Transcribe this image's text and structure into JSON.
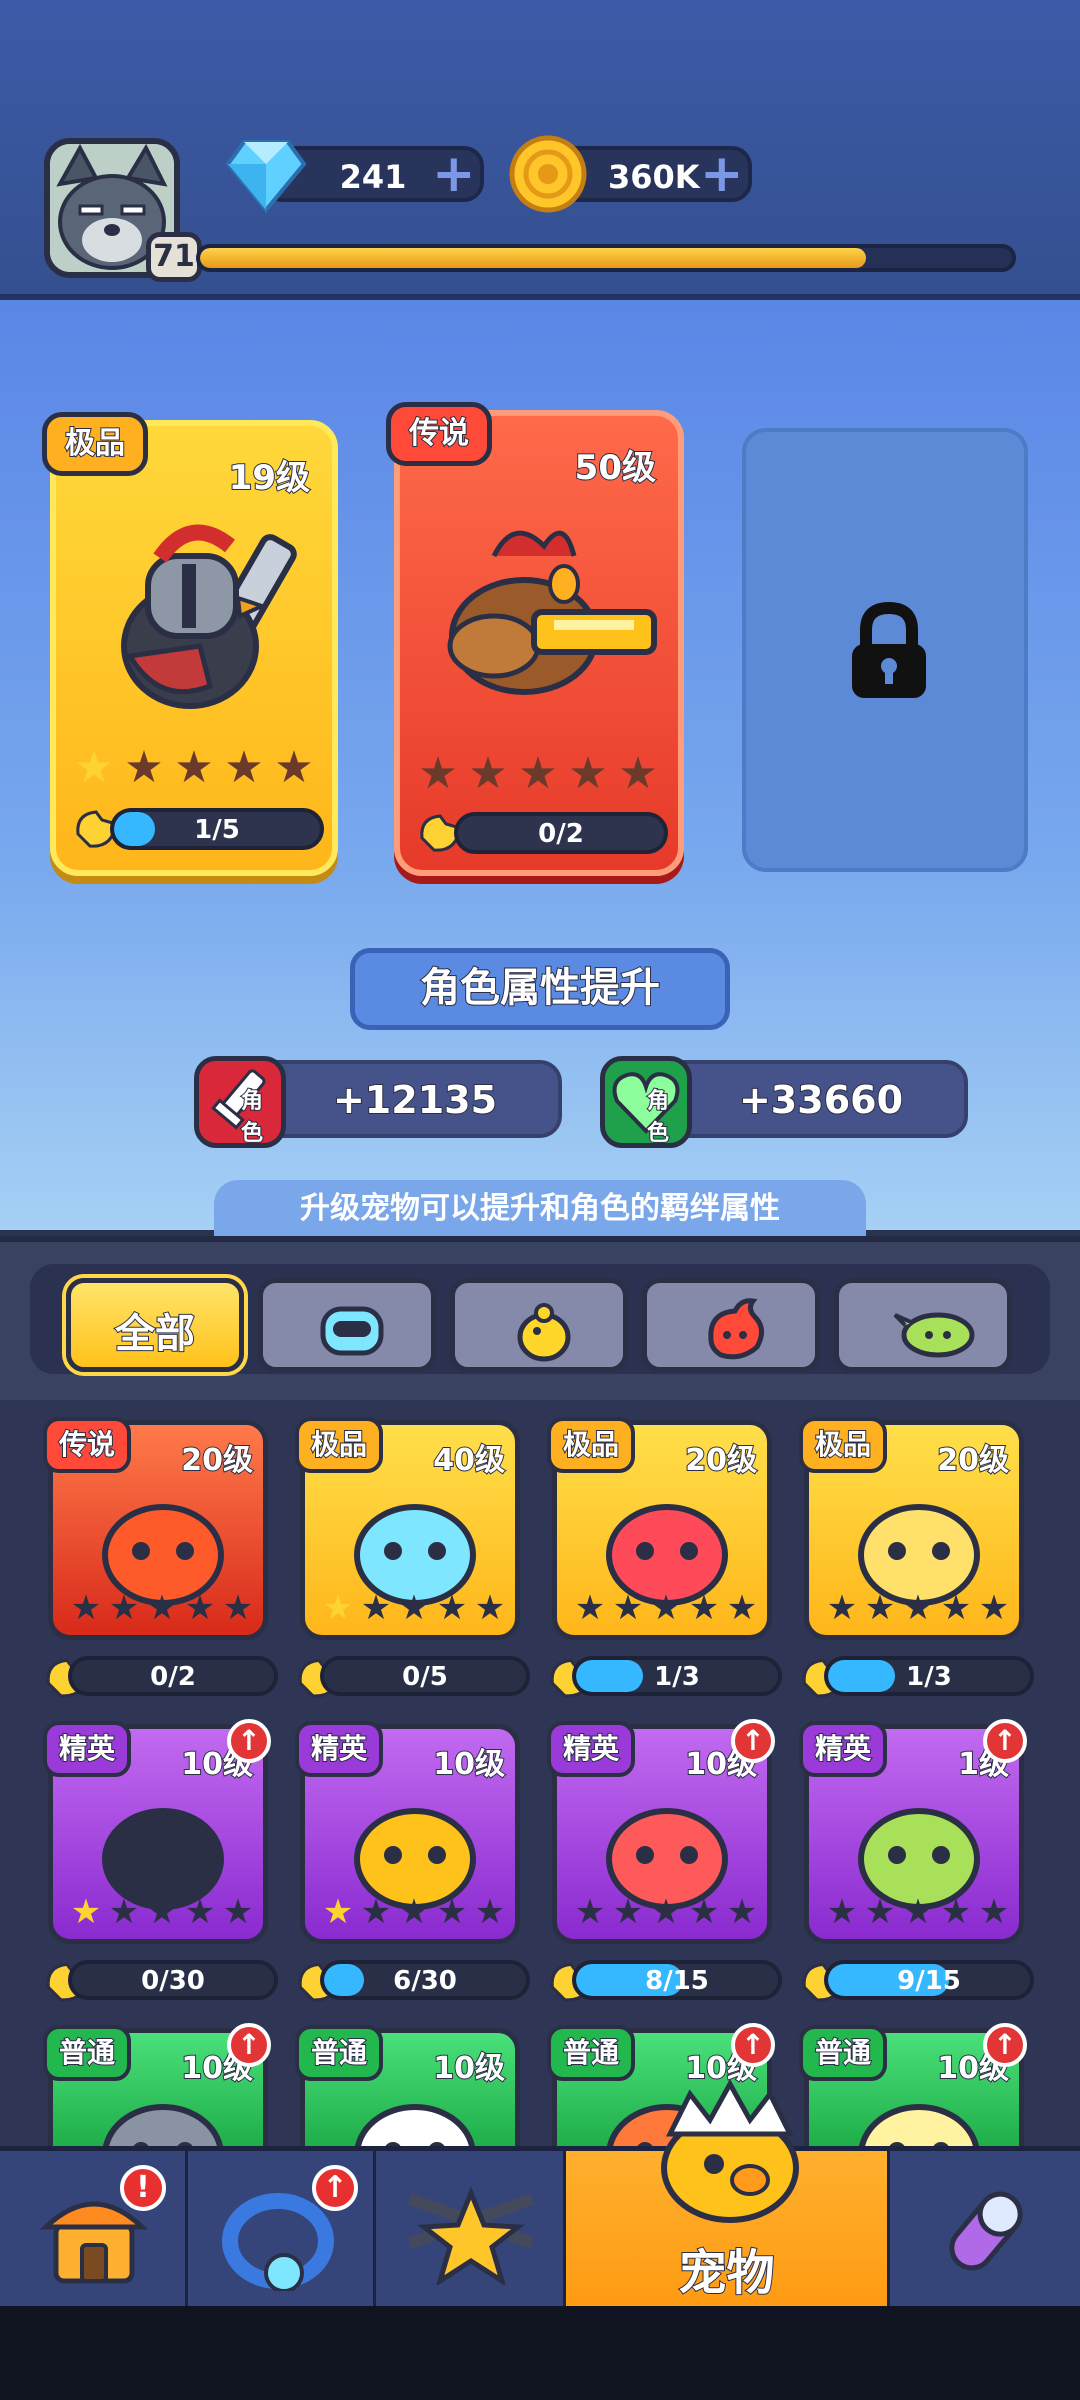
{
  "player": {
    "level": "71",
    "xp_fraction": 0.82
  },
  "currency": {
    "gems": "241",
    "gold": "360K"
  },
  "heroes": [
    {
      "rarity": "极品",
      "level": "19级",
      "stars_filled": 1,
      "progress": "1/5",
      "progress_fraction": 0.2
    },
    {
      "rarity": "传说",
      "level": "50级",
      "stars_filled": 0,
      "progress": "0/2",
      "progress_fraction": 0.0
    }
  ],
  "attributes": {
    "title": "角色属性提升",
    "attack": {
      "value": "+12135",
      "sub": "角色"
    },
    "health": {
      "value": "+33660",
      "sub": "角色"
    },
    "hint": "升级宠物可以提升和角色的羁绊属性"
  },
  "filters": {
    "all": "全部",
    "tabs": [
      "robot-icon",
      "chick-icon",
      "fire-blob-icon",
      "plant-icon"
    ]
  },
  "pets": [
    {
      "rarity": "传说",
      "level": "20级",
      "stars_filled": 0,
      "progress": "0/2",
      "progress_fraction": 0.0,
      "upgrade": false
    },
    {
      "rarity": "极品",
      "level": "40级",
      "stars_filled": 1,
      "progress": "0/5",
      "progress_fraction": 0.0,
      "upgrade": false
    },
    {
      "rarity": "极品",
      "level": "20级",
      "stars_filled": 0,
      "progress": "1/3",
      "progress_fraction": 0.33,
      "upgrade": false
    },
    {
      "rarity": "极品",
      "level": "20级",
      "stars_filled": 0,
      "progress": "1/3",
      "progress_fraction": 0.33,
      "upgrade": false
    },
    {
      "rarity": "精英",
      "level": "10级",
      "stars_filled": 1,
      "progress": "0/30",
      "progress_fraction": 0.0,
      "upgrade": true
    },
    {
      "rarity": "精英",
      "level": "10级",
      "stars_filled": 1,
      "progress": "6/30",
      "progress_fraction": 0.2,
      "upgrade": false
    },
    {
      "rarity": "精英",
      "level": "10级",
      "stars_filled": 0,
      "progress": "8/15",
      "progress_fraction": 0.53,
      "upgrade": true
    },
    {
      "rarity": "精英",
      "level": "1级",
      "stars_filled": 0,
      "progress": "9/15",
      "progress_fraction": 0.6,
      "upgrade": true
    },
    {
      "rarity": "普通",
      "level": "10级",
      "upgrade": true
    },
    {
      "rarity": "普通",
      "level": "10级",
      "upgrade": false
    },
    {
      "rarity": "普通",
      "level": "10级",
      "upgrade": true
    },
    {
      "rarity": "普通",
      "level": "10级",
      "upgrade": true
    }
  ],
  "nav": {
    "active_label": "宠物",
    "badge_shop": "!",
    "badge_ring": "↑"
  },
  "colors": {
    "legendary": "#ff5a3a",
    "epic": "#ffc21a",
    "elite": "#9a3ad8",
    "common": "#2fc65a"
  }
}
